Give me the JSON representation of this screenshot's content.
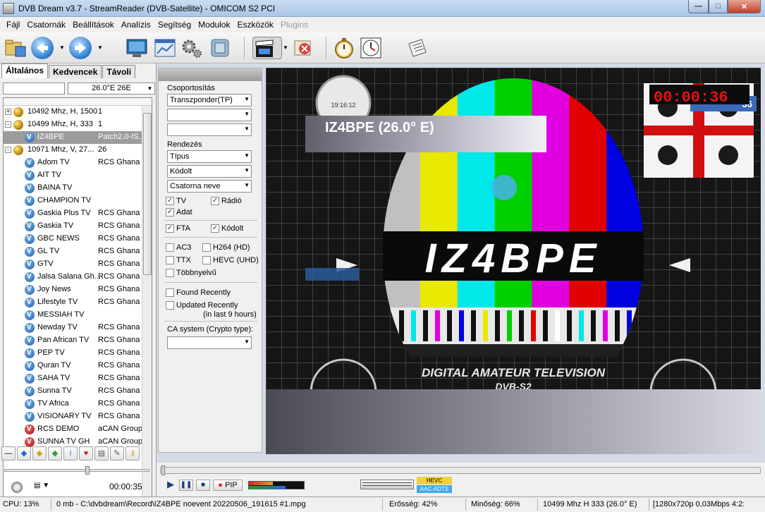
{
  "window": {
    "title": "DVB Dream v3.7 - StreamReader (DVB-Satellite)  - OMICOM S2 PCI",
    "minimize": "0",
    "maximize": "1",
    "close": "r"
  },
  "menu": [
    "Fájl",
    "Csatornák",
    "Beállítások",
    "Analízis",
    "Segítség",
    "Modulok",
    "Eszközök",
    "Plugins"
  ],
  "toolbar": {
    "icons": [
      "folder-icon",
      "back-icon",
      "forward-icon",
      "monitor-icon",
      "window-icon",
      "gear-icon",
      "settings-icon",
      "clapperboard-icon",
      "stop-record-icon",
      "stopwatch-icon",
      "epg-clock-icon",
      "newspaper-icon"
    ]
  },
  "left_panel": {
    "tabs": [
      "Általános",
      "Kedvencek",
      "Távoli"
    ],
    "satellite": "26.0°E 26E",
    "tree": [
      {
        "type": "sat",
        "expander": "+",
        "name": "10492 Mhz, H, 1500",
        "col2": "1"
      },
      {
        "type": "sat",
        "expander": "-",
        "name": "10499 Mhz, H, 333",
        "col2": "1"
      },
      {
        "type": "tv",
        "name": "IZ4BPE",
        "col2": "Patch2.0-IS...",
        "selected": true
      },
      {
        "type": "sat",
        "expander": "-",
        "name": "10971 Mhz, V, 27...",
        "col2": "26"
      },
      {
        "type": "tv",
        "name": "Adom TV",
        "col2": "RCS Ghana"
      },
      {
        "type": "tv",
        "name": "AIT TV",
        "col2": ""
      },
      {
        "type": "tv",
        "name": "BAINA TV",
        "col2": ""
      },
      {
        "type": "tv",
        "name": "CHAMPION TV",
        "col2": ""
      },
      {
        "type": "tv",
        "name": "Gaskia Plus TV",
        "col2": "RCS Ghana"
      },
      {
        "type": "tv",
        "name": "Gaskia TV",
        "col2": "RCS Ghana"
      },
      {
        "type": "tv",
        "name": "GBC NEWS",
        "col2": "RCS Ghana"
      },
      {
        "type": "tv",
        "name": "GL TV",
        "col2": "RCS Ghana"
      },
      {
        "type": "tv",
        "name": "GTV",
        "col2": "RCS Ghana"
      },
      {
        "type": "tv",
        "name": "Jalsa Salana Gh...",
        "col2": "RCS Ghana"
      },
      {
        "type": "tv",
        "name": "Joy News",
        "col2": "RCS Ghana"
      },
      {
        "type": "tv",
        "name": "Lifestyle TV",
        "col2": "RCS Ghana"
      },
      {
        "type": "tv",
        "name": "MESSIAH TV",
        "col2": ""
      },
      {
        "type": "tv",
        "name": "Newday TV",
        "col2": "RCS Ghana"
      },
      {
        "type": "tv",
        "name": "Pan African TV",
        "col2": "RCS Ghana"
      },
      {
        "type": "tv",
        "name": "PEP TV",
        "col2": "RCS Ghana"
      },
      {
        "type": "tv",
        "name": "Quran TV",
        "col2": "RCS Ghana"
      },
      {
        "type": "tv",
        "name": "SAHA TV",
        "col2": "RCS Ghana"
      },
      {
        "type": "tv",
        "name": "Sunna TV",
        "col2": "RCS Ghana"
      },
      {
        "type": "tv",
        "name": "TV Africa",
        "col2": "RCS Ghana"
      },
      {
        "type": "tv",
        "name": "VISIONARY TV",
        "col2": "RCS Ghana"
      },
      {
        "type": "enc",
        "name": "RCS DEMO",
        "col2": "aCAN Group"
      },
      {
        "type": "enc",
        "name": "SUNNA TV GH",
        "col2": "aCAN Group"
      }
    ],
    "timer": "00:00:35"
  },
  "filter": {
    "grouping_label": "Csoportosítás",
    "grouping_value": "Transzponder(TP)",
    "sort_label": "Rendezés",
    "sort_values": [
      "Típus",
      "Kódolt",
      "Csatorna neve"
    ],
    "chk_tv": "TV",
    "chk_radio": "Rádió",
    "chk_data": "Adat",
    "chk_fta": "FTA",
    "chk_coded": "Kódolt",
    "chk_ac3": "AC3",
    "chk_h264": "H264 (HD)",
    "chk_ttx": "TTX",
    "chk_hevc": "HEVC (UHD)",
    "chk_multilang": "Többnyelvű",
    "chk_found_recently": "Found Recently",
    "chk_updated_recently": "Updated Recently",
    "updated_note": "(in last 9 hours)",
    "ca_label": "CA system (Crypto type):"
  },
  "video": {
    "channel_overlay": "IZ4BPE (26.0° E)",
    "timer_overlay": "00:00:36",
    "logo_text": "IZ4BPE",
    "bottom_text": "DIGITAL AMATEUR TELEVISION",
    "bottom_text2": "DVB-S2",
    "clock_text": "19:16:12",
    "flag_behind_text": "36",
    "bar_colors": [
      "#c0c0c0",
      "#e8e800",
      "#00e8e8",
      "#00d000",
      "#e000e0",
      "#e00000",
      "#0000e0"
    ]
  },
  "player": {
    "pip": "PIP",
    "hevc": "HEVC",
    "aac": "AAC-ADTS"
  },
  "status": {
    "cpu": "CPU: 13%",
    "record": "0 mb - C:\\dvbdream\\Record\\IZ4BPE noevent 20220506_191615 #1.mpg",
    "strength": "Erősség: 42%",
    "quality": "Minőség: 66%",
    "transponder": "10499 Mhz  H  333  (26.0° E)",
    "video_info": "[1280x720p  0,03Mbps 4:2:"
  }
}
